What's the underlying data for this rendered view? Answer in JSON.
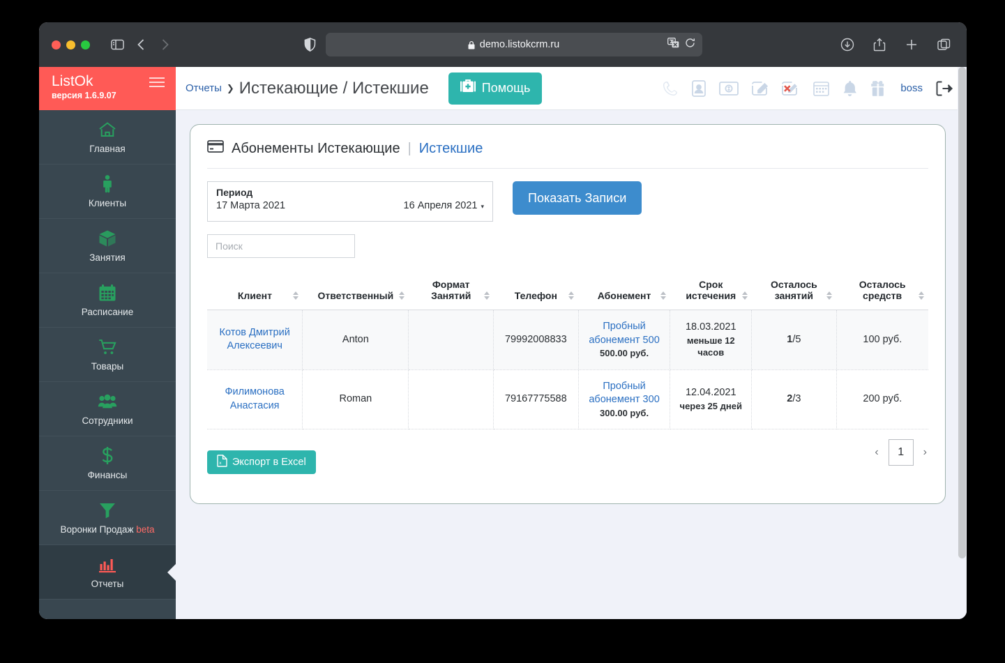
{
  "browser": {
    "url": "demo.listokcrm.ru",
    "lock_icon": "lock-icon",
    "shield_icon": "shield-icon",
    "sidebar_toggle_icon": "sidebar-toggle-icon",
    "back_icon": "chevron-left-icon",
    "forward_icon": "chevron-right-icon",
    "translate_icon": "translate-icon",
    "reload_icon": "reload-icon",
    "download_icon": "download-icon",
    "share_icon": "share-icon",
    "newtab_icon": "plus-icon",
    "tabs_icon": "tabs-icon"
  },
  "sidebar": {
    "brand": "ListOk",
    "version": "версия 1.6.9.07",
    "menu_icon": "hamburger-icon",
    "items": [
      {
        "label": "Главная",
        "icon": "home-icon",
        "active": false,
        "beta": ""
      },
      {
        "label": "Клиенты",
        "icon": "person-icon",
        "active": false,
        "beta": ""
      },
      {
        "label": "Занятия",
        "icon": "box-icon",
        "active": false,
        "beta": ""
      },
      {
        "label": "Расписание",
        "icon": "calendar-icon",
        "active": false,
        "beta": ""
      },
      {
        "label": "Товары",
        "icon": "cart-icon",
        "active": false,
        "beta": ""
      },
      {
        "label": "Сотрудники",
        "icon": "users-icon",
        "active": false,
        "beta": ""
      },
      {
        "label": "Финансы",
        "icon": "dollar-icon",
        "active": false,
        "beta": ""
      },
      {
        "label": "Воронки Продаж",
        "icon": "funnel-icon",
        "active": false,
        "beta": "beta"
      },
      {
        "label": "Отчеты",
        "icon": "barchart-icon",
        "active": true,
        "beta": ""
      }
    ]
  },
  "topbar": {
    "breadcrumb_link": "Отчеты",
    "breadcrumb_sep": "❯",
    "breadcrumb_title": "Истекающие / Истекшие",
    "help_label": "Помощь",
    "help_icon": "first-aid-kit-icon",
    "help_color": "#2eb5ad",
    "icons": [
      "phone-icon",
      "id-card-icon",
      "money-icon",
      "edit-icon",
      "edit-delete-icon",
      "calendar-icon",
      "bell-icon",
      "gift-icon"
    ],
    "user": "boss",
    "logout_icon": "logout-icon"
  },
  "card": {
    "icon": "card-icon",
    "title": "Абонементы Истекающие",
    "separator": "|",
    "tab_link": "Истекшие",
    "period": {
      "caption": "Период",
      "start": "17 Марта 2021",
      "end": "16 Апреля 2021",
      "caret": "▾"
    },
    "show_button": "Показать Записи",
    "show_button_color": "#3d8ccd",
    "search_placeholder": "Поиск",
    "search_value": ""
  },
  "table": {
    "columns": [
      "Клиент",
      "Ответственный",
      "Формат Занятий",
      "Телефон",
      "Абонемент",
      "Срок истечения",
      "Осталось занятий",
      "Осталось средств"
    ],
    "rows": [
      {
        "client": "Котов Дмитрий Алексеевич",
        "responsible": "Anton",
        "format": "",
        "phone": "79992008833",
        "subscription": "Пробный абонемент 500",
        "subscription_price": "500.00 руб.",
        "expiry_date": "18.03.2021",
        "expiry_note": "меньше 12 часов",
        "lessons_left": "1",
        "lessons_total": "/5",
        "funds_left": "100 руб."
      },
      {
        "client": "Филимонова Анастасия",
        "responsible": "Roman",
        "format": "",
        "phone": "79167775588",
        "subscription": "Пробный абонемент 300",
        "subscription_price": "300.00 руб.",
        "expiry_date": "12.04.2021",
        "expiry_note": "через 25 дней",
        "lessons_left": "2",
        "lessons_total": "/3",
        "funds_left": "200 руб."
      }
    ]
  },
  "footer": {
    "export_label": "Экспорт в Excel",
    "export_icon": "excel-file-icon",
    "export_color": "#2eb5ad",
    "prev": "‹",
    "page": "1",
    "next": "›"
  }
}
